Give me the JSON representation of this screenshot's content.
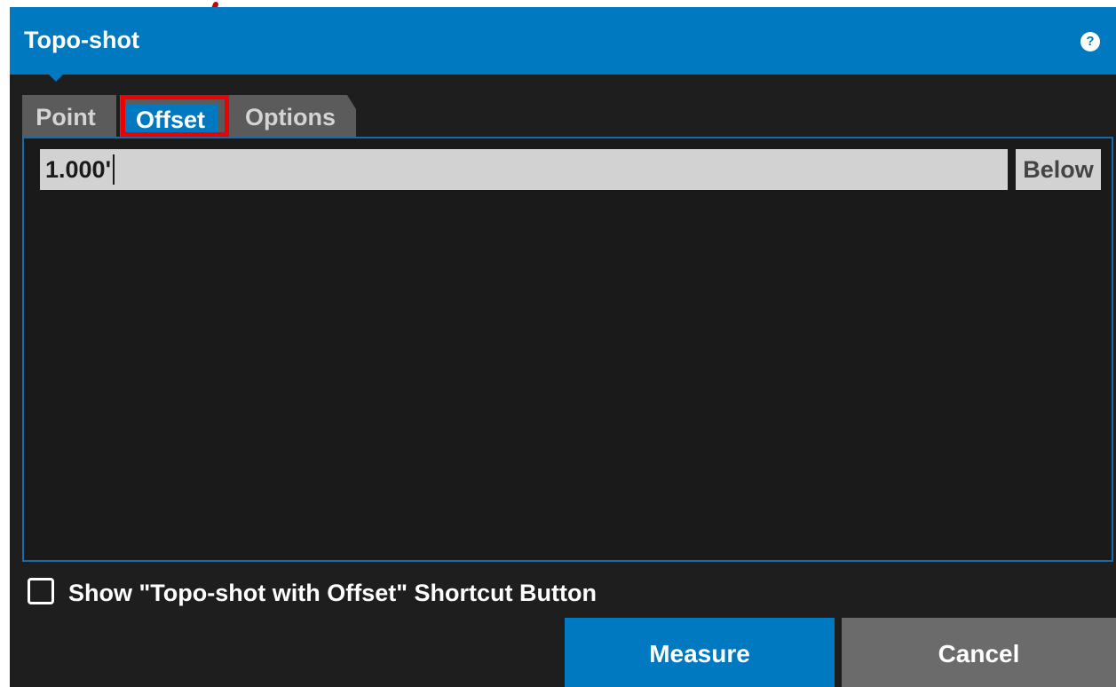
{
  "dialog": {
    "title": "Topo-shot",
    "help_icon": "help-icon",
    "help_glyph": "?"
  },
  "tabs": [
    {
      "label": "Point",
      "selected": false
    },
    {
      "label": "Offset",
      "selected": true
    },
    {
      "label": "Options",
      "selected": false
    }
  ],
  "offset": {
    "value": "1.000'",
    "direction": "Below"
  },
  "shortcut_option": {
    "label": "Show \"Topo-shot with Offset\" Shortcut Button",
    "checked": false
  },
  "actions": {
    "measure_label": "Measure",
    "cancel_label": "Cancel"
  },
  "colors": {
    "accent": "#0079c1",
    "background": "#1e1e1e",
    "annotation": "#ee0000"
  }
}
